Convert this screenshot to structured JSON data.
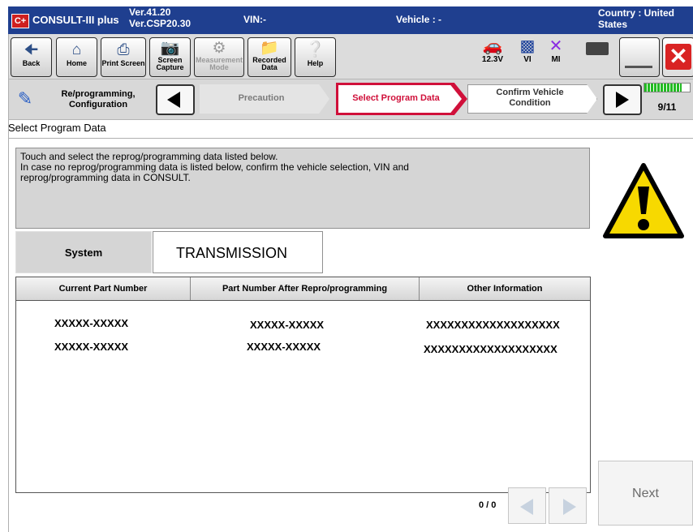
{
  "app": {
    "logo_text": "C+",
    "name": "CONSULT-III plus",
    "version_line1": "Ver.41.20",
    "version_line2": "Ver.CSP20.30",
    "vin": "VIN:-",
    "vehicle": "Vehicle : -",
    "country_line1": "Country : United",
    "country_line2": "States"
  },
  "toolbar": {
    "back": "Back",
    "home": "Home",
    "print_screen": "Print Screen",
    "screen_capture_1": "Screen",
    "screen_capture_2": "Capture",
    "measurement_1": "Measurement",
    "measurement_2": "Mode",
    "recorded_1": "Recorded",
    "recorded_2": "Data",
    "help": "Help",
    "battery_voltage": "12.3V",
    "vi_label": "VI",
    "mi_label": "MI"
  },
  "breadcrumb": {
    "section_1": "Re/programming,",
    "section_2": "Configuration",
    "step_prev": "Precaution",
    "step_current": "Select Program Data",
    "step_next_1": "Confirm Vehicle",
    "step_next_2": "Condition",
    "step_count": "9/11",
    "progress_fraction": 0.82
  },
  "main": {
    "title": "Select Program Data",
    "instruction_1": "Touch and select the reprog/programming data listed below.",
    "instruction_2": "In case no reprog/programming data is listed below, confirm the vehicle selection, VIN and",
    "instruction_3": "reprog/programming data in CONSULT.",
    "system_label": "System",
    "system_value": "TRANSMISSION"
  },
  "table": {
    "headers": [
      "Current Part Number",
      "Part Number After Repro/programming",
      "Other Information"
    ],
    "rows": [
      [
        "XXXXX-XXXXX",
        "XXXXX-XXXXX",
        "XXXXXXXXXXXXXXXXXXX"
      ],
      [
        "XXXXX-XXXXX",
        "XXXXX-XXXXX",
        "XXXXXXXXXXXXXXXXXXX"
      ]
    ]
  },
  "pager": {
    "text": "0 / 0"
  },
  "buttons": {
    "next": "Next"
  },
  "colors": {
    "title_bar": "#1f3f8f",
    "current_step_border": "#d0103a",
    "progress_green": "#22bb22",
    "warning_yellow": "#f7d900",
    "close_red": "#d92323"
  }
}
